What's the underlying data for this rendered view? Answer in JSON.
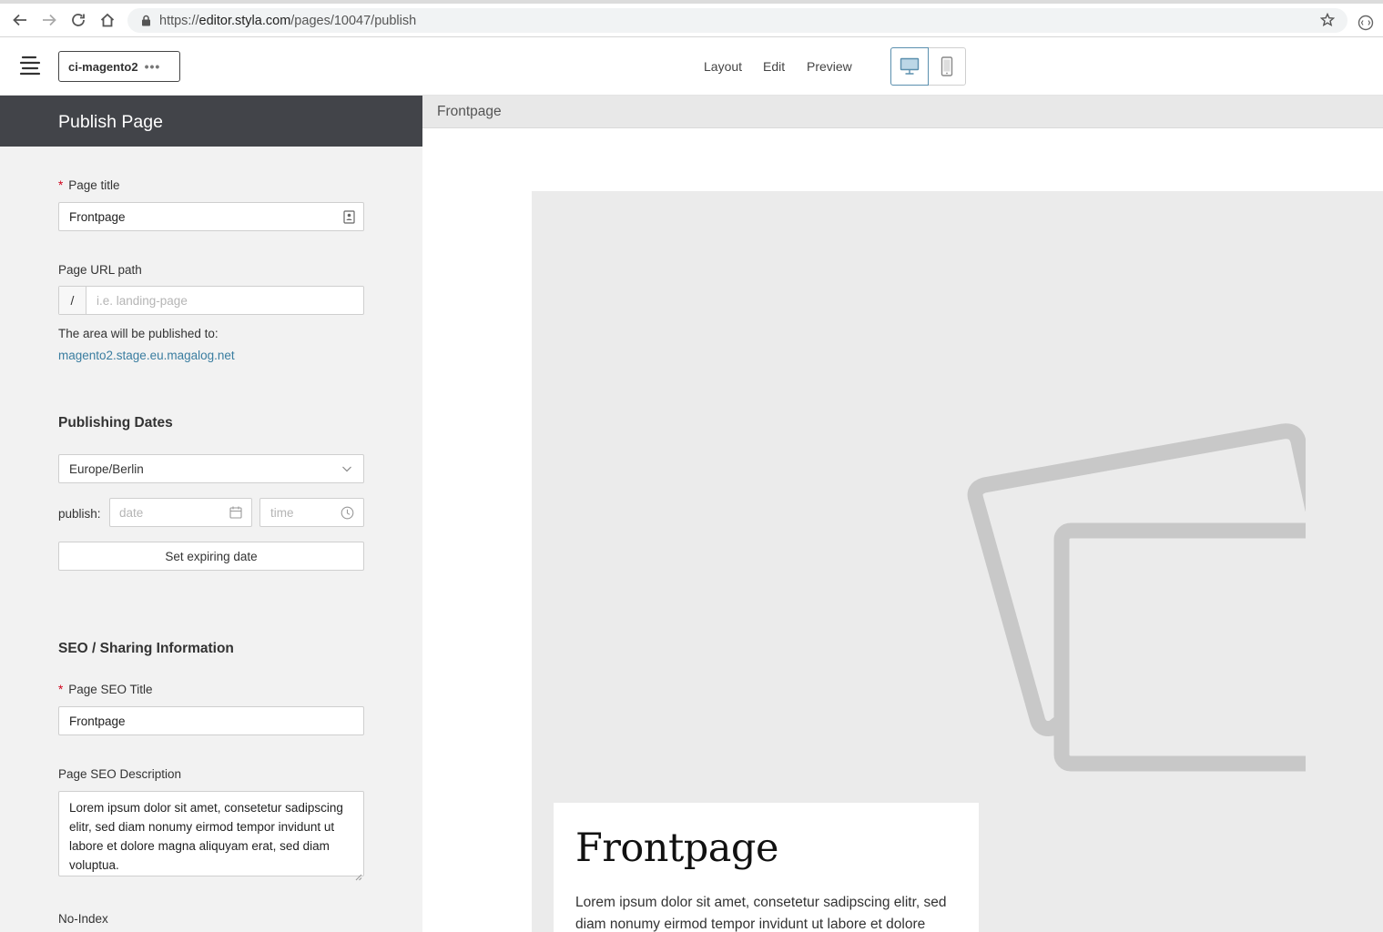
{
  "browser": {
    "url_prefix": "https://",
    "url_host": "editor.styla.com",
    "url_path": "/pages/10047/publish"
  },
  "header": {
    "workspace": "ci-magento2",
    "workspace_more": "•••",
    "nav": {
      "layout": "Layout",
      "edit": "Edit",
      "preview": "Preview"
    },
    "active_device": "desktop"
  },
  "sidebar": {
    "title": "Publish Page",
    "page_title": {
      "required_mark": "*",
      "label": "Page title",
      "value": "Frontpage"
    },
    "url_path": {
      "label": "Page URL path",
      "prefix": "/",
      "placeholder": "i.e. landing-page",
      "info": "The area will be published to:",
      "domain": "magento2.stage.eu.magalog.net"
    },
    "publishing": {
      "title": "Publishing Dates",
      "timezone": "Europe/Berlin",
      "publish_label": "publish:",
      "date_placeholder": "date",
      "time_placeholder": "time",
      "expiring_button": "Set expiring date"
    },
    "seo": {
      "title": "SEO / Sharing Information",
      "seo_title_required": "*",
      "seo_title_label": "Page SEO Title",
      "seo_title_value": "Frontpage",
      "description_label": "Page SEO Description",
      "description_value": "Lorem ipsum dolor sit amet, consetetur sadipscing elitr, sed diam nonumy eirmod tempor invidunt ut labore et dolore magna aliquyam erat, sed diam voluptua.",
      "noindex_label": "No-Index"
    }
  },
  "preview": {
    "bar_title": "Frontpage",
    "card_title": "Frontpage",
    "card_body": "Lorem ipsum dolor sit amet, consetetur sadipscing elitr, sed diam nonumy eirmod tempor invidunt ut labore et dolore"
  },
  "colors": {
    "sidebar_header": "#424449",
    "link": "#3a7da0",
    "required": "#d0021b",
    "active_device": "#5a8fae"
  }
}
